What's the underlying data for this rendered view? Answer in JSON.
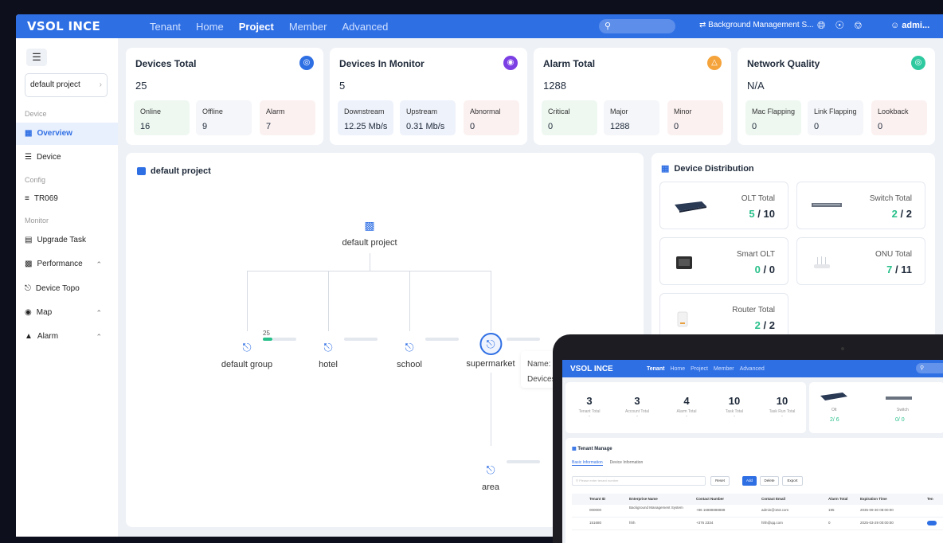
{
  "app": {
    "brand": "VSOL INCE",
    "nav": [
      "Tenant",
      "Home",
      "Project",
      "Member",
      "Advanced"
    ],
    "nav_active": "Project",
    "background_mgmt": "Background Management S...",
    "user": "admi..."
  },
  "sidebar": {
    "project_select": "default project",
    "sections": {
      "device": "Device",
      "config": "Config",
      "monitor": "Monitor"
    },
    "items": {
      "overview": "Overview",
      "device": "Device",
      "tr069": "TR069",
      "upgrade_task": "Upgrade Task",
      "performance": "Performance",
      "device_topo": "Device Topo",
      "map": "Map",
      "alarm": "Alarm"
    }
  },
  "stats": {
    "devices_total": {
      "title": "Devices Total",
      "value": "25",
      "chips": [
        {
          "label": "Online",
          "value": "16"
        },
        {
          "label": "Offline",
          "value": "9"
        },
        {
          "label": "Alarm",
          "value": "7"
        }
      ]
    },
    "devices_in_monitor": {
      "title": "Devices In Monitor",
      "value": "5",
      "chips": [
        {
          "label": "Downstream",
          "value": "12.25 Mb/s"
        },
        {
          "label": "Upstream",
          "value": "0.31 Mb/s"
        },
        {
          "label": "Abnormal",
          "value": "0"
        }
      ]
    },
    "alarm_total": {
      "title": "Alarm Total",
      "value": "1288",
      "chips": [
        {
          "label": "Critical",
          "value": "0"
        },
        {
          "label": "Major",
          "value": "1288"
        },
        {
          "label": "Minor",
          "value": "0"
        }
      ]
    },
    "network_quality": {
      "title": "Network Quality",
      "value": "N/A",
      "chips": [
        {
          "label": "Mac Flapping",
          "value": "0"
        },
        {
          "label": "Link Flapping",
          "value": "0"
        },
        {
          "label": "Lookback",
          "value": "0"
        }
      ]
    }
  },
  "colors": {
    "accent": "#2f6fe4",
    "green": "#28c08a",
    "purple": "#7b3fe4",
    "orange": "#f5a33b",
    "teal": "#2fc9a0"
  },
  "topology": {
    "title": "default project",
    "root": "default project",
    "children": [
      "default group",
      "hotel",
      "school",
      "supermarket"
    ],
    "grandchild": "area",
    "group_count": "25",
    "tooltip": {
      "name_label": "Name:",
      "devices_label": "Devices"
    }
  },
  "distribution": {
    "title": "Device Distribution",
    "items": {
      "olt": {
        "label": "OLT Total",
        "online": "5",
        "total": "10"
      },
      "switch": {
        "label": "Switch Total",
        "online": "2",
        "total": "2"
      },
      "smart_olt": {
        "label": "Smart OLT",
        "online": "0",
        "total": "0"
      },
      "onu": {
        "label": "ONU Total",
        "online": "7",
        "total": "11"
      },
      "router": {
        "label": "Router Total",
        "online": "2",
        "total": "2"
      }
    },
    "separator": "/"
  },
  "tablet": {
    "brand": "VSOL INCE",
    "nav": [
      "Tenant",
      "Home",
      "Project",
      "Member",
      "Advanced"
    ],
    "stats": [
      {
        "value": "3",
        "label": "Tenant Total",
        "delta": "-"
      },
      {
        "value": "3",
        "label": "Account Total",
        "delta": "-"
      },
      {
        "value": "4",
        "label": "Alarm Total",
        "delta": "-"
      },
      {
        "value": "10",
        "label": "Task Total",
        "delta": "-"
      },
      {
        "value": "10",
        "label": "Task Run Total",
        "delta": "-"
      }
    ],
    "devices": {
      "olt_label": "Olt",
      "olt_value": "2/ 6",
      "switch_label": "Switch",
      "switch_value": "0/ 0"
    },
    "manage": {
      "title": "Tenant Manage",
      "tabs": [
        "Basic Information",
        "Device Information"
      ],
      "search_placeholder": "Please enter tenant number",
      "buttons": {
        "reset": "Reset",
        "add": "Add",
        "delete": "Delete",
        "export": "Export"
      },
      "columns": [
        "Tenant ID",
        "Enterprise Name",
        "Contact Number",
        "Contact Email",
        "Alarm Total",
        "Expiration Time",
        "Ten"
      ],
      "rows": [
        [
          "000000",
          "Background Management System",
          "+86 16888888888",
          "admin@163.com",
          "195",
          "2035-09-30 08:00:00"
        ],
        [
          "151680",
          "hhh",
          "+376 2334",
          "hhh@qq.com",
          "0",
          "2025-03-29 00:00:00"
        ]
      ]
    }
  }
}
